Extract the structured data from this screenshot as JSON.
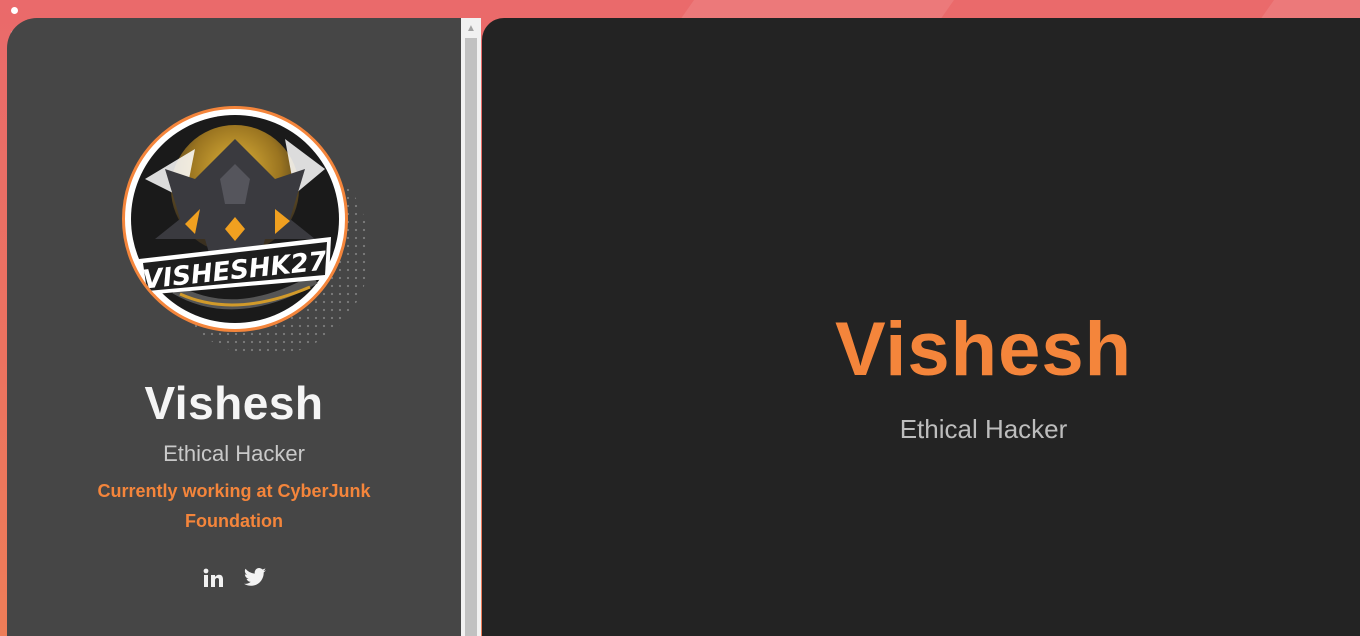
{
  "profile": {
    "avatar_text": "VISHESHK27",
    "name": "Vishesh",
    "title": "Ethical Hacker",
    "work_line1": "Currently working at CyberJunk",
    "work_line2": "Foundation",
    "socials": [
      {
        "name": "LinkedIn",
        "icon": "linkedin-icon"
      },
      {
        "name": "Twitter",
        "icon": "twitter-icon"
      }
    ]
  },
  "main": {
    "name": "Vishesh",
    "title": "Ethical Hacker"
  },
  "colors": {
    "accent": "#f4853b",
    "sidebar_bg": "#464646",
    "main_bg": "#232323",
    "page_gradient_top": "#ea6a6b",
    "page_gradient_bottom": "#ee7d58"
  }
}
